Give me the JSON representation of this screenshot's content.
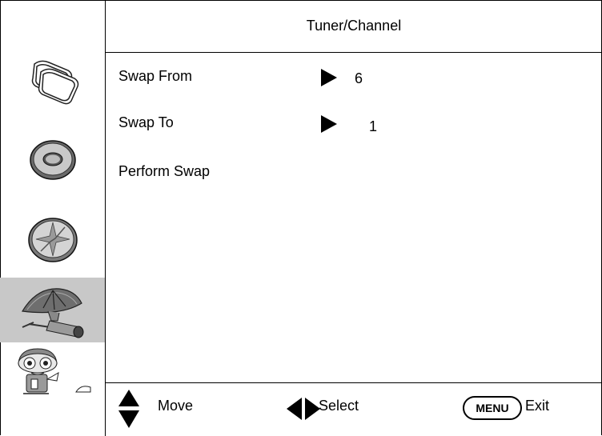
{
  "header": {
    "title": "Tuner/Channel"
  },
  "sidebar": {
    "items": [
      {
        "name": "picture-icon",
        "active": false
      },
      {
        "name": "disc-icon",
        "active": false
      },
      {
        "name": "compass-icon",
        "active": false
      },
      {
        "name": "satellite-dish-icon",
        "active": true
      },
      {
        "name": "character-icon",
        "active": false
      }
    ]
  },
  "menu": {
    "rows": [
      {
        "label": "Swap From",
        "value": "6"
      },
      {
        "label": "Swap To",
        "value": "1"
      },
      {
        "label": "Perform Swap",
        "value": ""
      }
    ]
  },
  "footer": {
    "move_label": "Move",
    "select_label": "Select",
    "menu_key": "MENU",
    "exit_label": "Exit"
  },
  "colors": {
    "active_bg": "#c8c8c8",
    "line": "#000000"
  }
}
